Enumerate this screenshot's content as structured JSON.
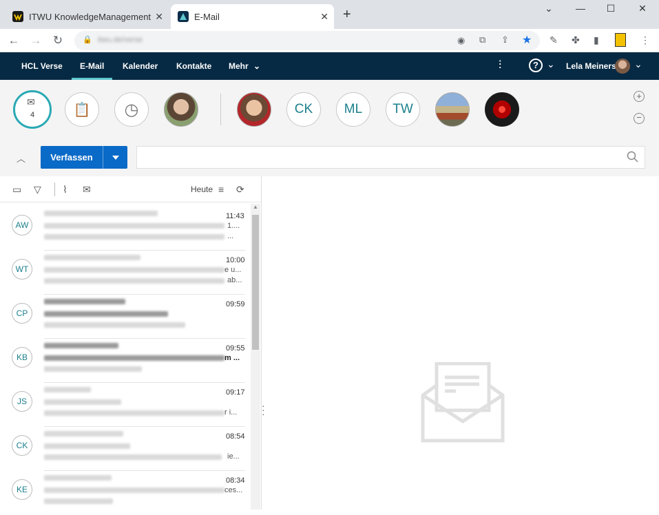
{
  "browser": {
    "tabs": [
      {
        "title": "ITWU KnowledgeManagement",
        "favicon": "itwu-logo-icon"
      },
      {
        "title": "E-Mail",
        "favicon": "verse-logo-icon"
      }
    ],
    "new_tab": "+",
    "url": "itwu.de/verse"
  },
  "nav": {
    "items": [
      "HCL Verse",
      "E-Mail",
      "Kalender",
      "Kontakte",
      "Mehr"
    ],
    "active": "E-Mail",
    "user_name": "Lela Meiners"
  },
  "bizcards": {
    "inbox_count": "4",
    "initials": [
      "CK",
      "ML",
      "TW"
    ]
  },
  "toolbar": {
    "compose_label": "Verfassen",
    "sort_label": "Heute"
  },
  "mails": [
    {
      "initials": "AW",
      "time": "11:43",
      "subj_tail": "1....",
      "prev_tail": "..."
    },
    {
      "initials": "WT",
      "time": "10:00",
      "subj_tail": "e u...",
      "prev_tail": "ab..."
    },
    {
      "initials": "CP",
      "time": "09:59",
      "subj_tail": "",
      "prev_tail": ""
    },
    {
      "initials": "KB",
      "time": "09:55",
      "subj_tail": "m ...",
      "prev_tail": ""
    },
    {
      "initials": "JS",
      "time": "09:17",
      "subj_tail": "",
      "prev_tail": "r i..."
    },
    {
      "initials": "CK",
      "time": "08:54",
      "subj_tail": "",
      "prev_tail": "ie..."
    },
    {
      "initials": "KE",
      "time": "08:34",
      "subj_tail": "ces...",
      "prev_tail": ""
    }
  ],
  "colors": {
    "header": "#072a44",
    "accent": "#5fc8d0",
    "compose": "#0a6ac7",
    "initials": "#1b7f8c"
  }
}
